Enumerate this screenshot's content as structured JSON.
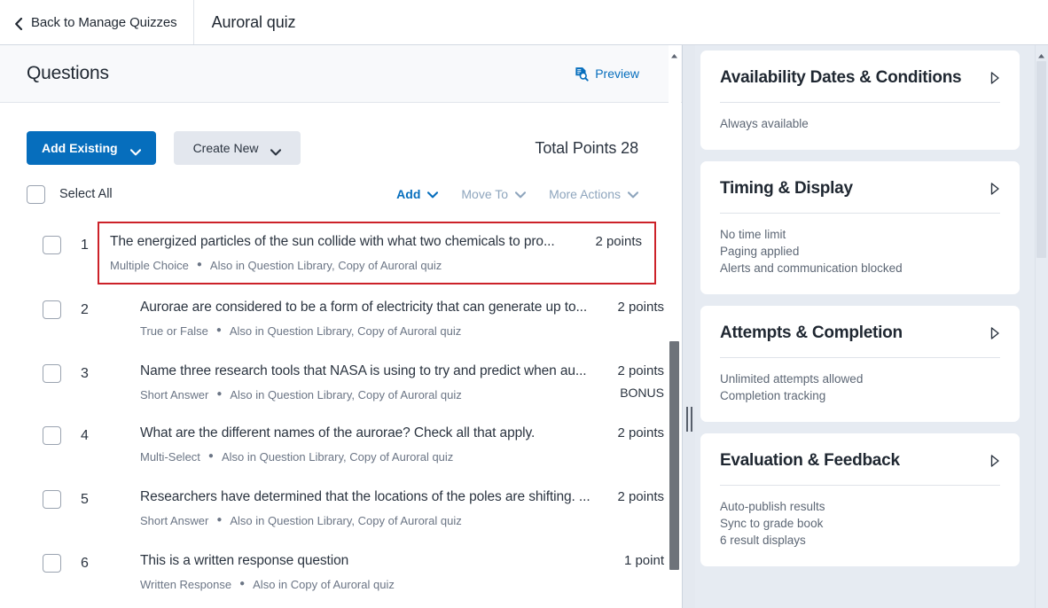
{
  "topbar": {
    "back_label": "Back to Manage Quizzes",
    "back_icon": "chevron-left-icon",
    "quiz_title": "Auroral quiz"
  },
  "questions_panel": {
    "header_title": "Questions",
    "preview_label": "Preview",
    "preview_icon": "document-search-icon",
    "add_existing_label": "Add Existing",
    "create_new_label": "Create New",
    "total_points_label": "Total Points 28",
    "select_all_label": "Select All",
    "actions": [
      {
        "label": "Add",
        "state": "enabled"
      },
      {
        "label": "Move To",
        "state": "disabled"
      },
      {
        "label": "More Actions",
        "state": "disabled"
      }
    ],
    "questions": [
      {
        "number": "1",
        "text": "The energized particles of the sun collide with what two chemicals to pro...",
        "type": "Multiple Choice",
        "location": "Also in Question Library, Copy of Auroral quiz",
        "points": "2 points",
        "bonus": "",
        "highlighted": true
      },
      {
        "number": "2",
        "text": "Aurorae are considered to be a form of electricity that can generate up to...",
        "type": "True or False",
        "location": "Also in Question Library, Copy of Auroral quiz",
        "points": "2 points",
        "bonus": "",
        "highlighted": false
      },
      {
        "number": "3",
        "text": "Name three research tools that NASA is using to try and predict when au...",
        "type": "Short Answer",
        "location": "Also in Question Library, Copy of Auroral quiz",
        "points": "2 points",
        "bonus": "BONUS",
        "highlighted": false
      },
      {
        "number": "4",
        "text": "What are the different names of the aurorae? Check all that apply.",
        "type": "Multi-Select",
        "location": "Also in Question Library, Copy of Auroral quiz",
        "points": "2 points",
        "bonus": "",
        "highlighted": false
      },
      {
        "number": "5",
        "text": "Researchers have determined that the locations of the poles are shifting. ...",
        "type": "Short Answer",
        "location": "Also in Question Library, Copy of Auroral quiz",
        "points": "2 points",
        "bonus": "",
        "highlighted": false
      },
      {
        "number": "6",
        "text": "This is a written response question",
        "type": "Written Response",
        "location": "Also in Copy of Auroral quiz",
        "points": "1 point",
        "bonus": "",
        "highlighted": false
      }
    ]
  },
  "settings_panel": {
    "cards": [
      {
        "title": "Availability Dates & Conditions",
        "arrow_icon": "triangle-right-icon",
        "lines": [
          "Always available"
        ]
      },
      {
        "title": "Timing & Display",
        "arrow_icon": "triangle-right-icon",
        "lines": [
          "No time limit",
          "Paging applied",
          "Alerts and communication blocked"
        ]
      },
      {
        "title": "Attempts & Completion",
        "arrow_icon": "triangle-right-icon",
        "lines": [
          "Unlimited attempts allowed",
          "Completion tracking"
        ]
      },
      {
        "title": "Evaluation & Feedback",
        "arrow_icon": "triangle-right-icon",
        "lines": [
          "Auto-publish results",
          "Sync to grade book",
          "6 result displays"
        ]
      }
    ]
  },
  "colors": {
    "accent_blue": "#066ebd",
    "highlight_red": "#cc2229",
    "panel_bg": "#e6ebf2",
    "text_primary": "#2b3440",
    "text_muted": "#6b7585"
  }
}
